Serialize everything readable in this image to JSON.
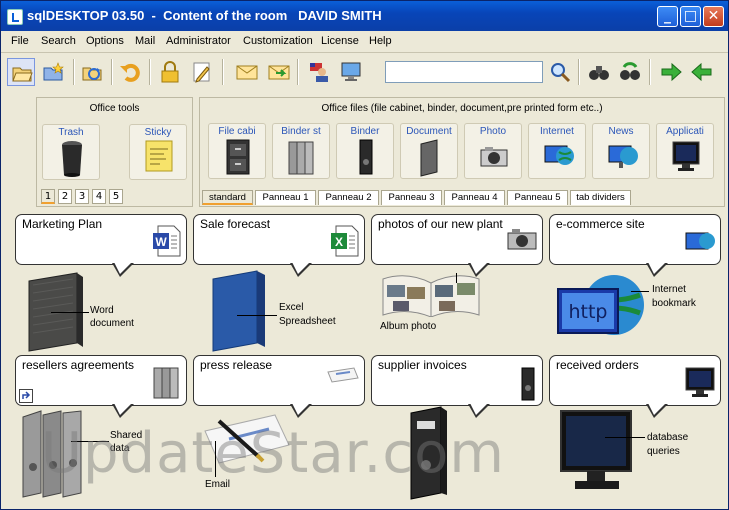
{
  "window": {
    "title": "sqlDESKTOP 03.50  -  Content of the room   DAVID SMITH",
    "minimize_label": "_",
    "maximize_label": "□",
    "close_label": "✕"
  },
  "menu": [
    "File",
    "Search",
    "Options",
    "Mail",
    "Administrator",
    "Customization",
    "License",
    "Help"
  ],
  "toolbar": {
    "icons": [
      "open-folder-icon",
      "folder-star-icon",
      "refresh-folder-icon",
      "undo-icon",
      "lock-icon",
      "pencil-icon",
      "mail-icon",
      "mail-forward-icon",
      "user-flag-icon",
      "monitor-icon",
      "search-magnifier-icon",
      "binoculars-icon",
      "binoculars-refresh-icon",
      "forward-arrow-icon",
      "back-arrow-icon"
    ],
    "search_value": ""
  },
  "office_tools": {
    "title": "Office tools",
    "items": [
      "Trash",
      "Sticky"
    ],
    "pages": [
      "1",
      "2",
      "3",
      "4",
      "5"
    ]
  },
  "office_files": {
    "title": "Office files (file cabinet, binder, document,pre printed form etc..)",
    "items": [
      "File cabi",
      "Binder st",
      "Binder",
      "Document",
      "Photo",
      "Internet",
      "News",
      "Applicati"
    ],
    "tabs": [
      "standard",
      "Panneau 1",
      "Panneau 2",
      "Panneau 3",
      "Panneau 4",
      "Panneau 5",
      "tab dividers"
    ]
  },
  "desktop": {
    "items": [
      {
        "label": "Marketing Plan",
        "note": "Word\ndocument"
      },
      {
        "label": "Sale forecast",
        "note": "Excel\nSpreadsheet"
      },
      {
        "label": "photos of our new plant",
        "note": "Album photo"
      },
      {
        "label": "e-commerce site",
        "note": "Internet\nbookmark"
      },
      {
        "label": "resellers agreements",
        "note": "Shared\ndata"
      },
      {
        "label": "press release",
        "note": "Email"
      },
      {
        "label": "supplier invoices",
        "note": ""
      },
      {
        "label": "received orders",
        "note": "database\nqueries"
      }
    ],
    "http_text": "http",
    "news_text": "news",
    "word_letter": "W",
    "excel_letter": "X"
  },
  "watermark": "UpdateStar.com"
}
